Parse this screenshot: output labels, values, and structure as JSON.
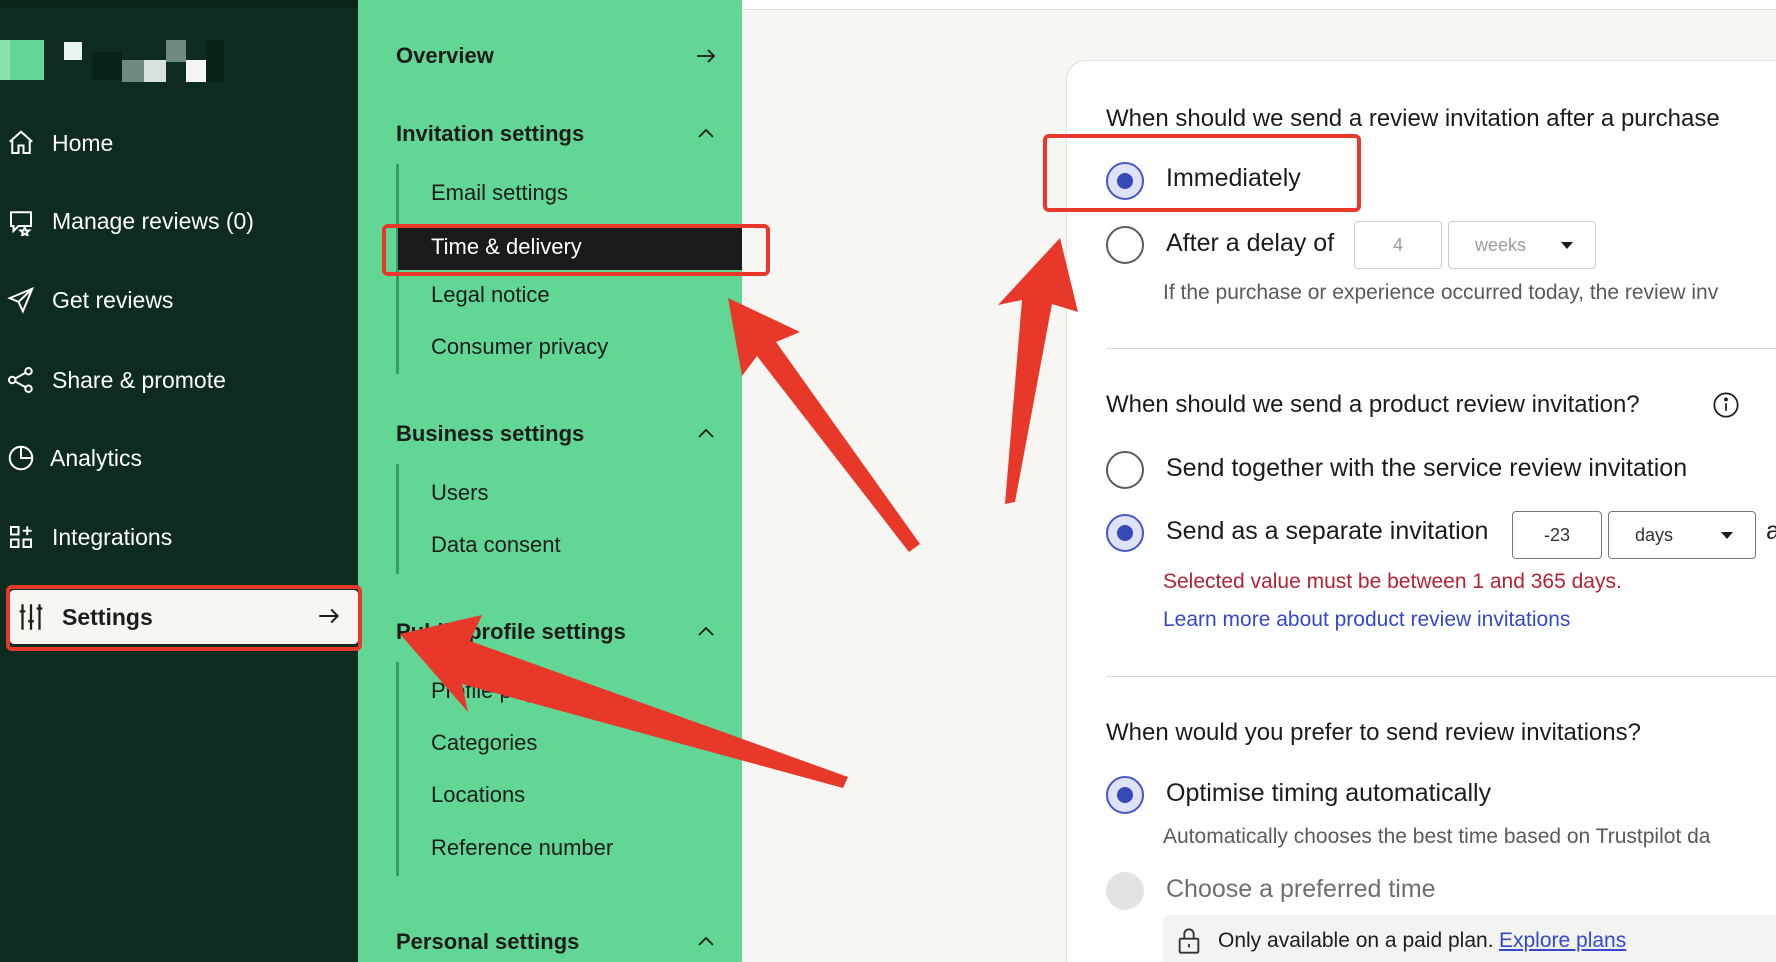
{
  "sidebar": {
    "items": [
      {
        "label": "Home",
        "icon": "home-icon"
      },
      {
        "label": "Manage reviews (0)",
        "icon": "star-chat-icon"
      },
      {
        "label": "Get reviews",
        "icon": "send-icon"
      },
      {
        "label": "Share & promote",
        "icon": "share-icon"
      },
      {
        "label": "Analytics",
        "icon": "pie-chart-icon"
      },
      {
        "label": "Integrations",
        "icon": "grid-plus-icon"
      }
    ],
    "active": {
      "label": "Settings",
      "icon": "sliders-icon"
    }
  },
  "menu": {
    "overview": "Overview",
    "invitation_settings": {
      "title": "Invitation settings",
      "items": [
        "Email settings",
        "Time & delivery",
        "Legal notice",
        "Consumer privacy"
      ]
    },
    "business_settings": {
      "title": "Business settings",
      "items": [
        "Users",
        "Data consent"
      ]
    },
    "public_profile_settings": {
      "title": "Public profile settings",
      "items": [
        "Profile page",
        "Categories",
        "Locations",
        "Reference number"
      ]
    },
    "personal_settings": {
      "title": "Personal settings"
    }
  },
  "content": {
    "q1": {
      "question": "When should we send a review invitation after a purchase",
      "opt_immediately": "Immediately",
      "opt_delay": "After a delay of",
      "delay_value": "4",
      "delay_unit": "weeks",
      "hint": "If the purchase or experience occurred today, the review inv"
    },
    "q2": {
      "question": "When should we send a product review invitation?",
      "opt_together": "Send together with the service review invitation",
      "opt_separate": "Send as a separate invitation",
      "separate_value": "-23",
      "separate_unit": "days",
      "trailing": "a",
      "error": "Selected value must be between 1 and 365 days.",
      "learn_more": "Learn more about product review invitations"
    },
    "q3": {
      "question": "When would you prefer to send review invitations?",
      "opt_auto": "Optimise timing automatically",
      "auto_hint": "Automatically chooses the best time based on Trustpilot da",
      "opt_preferred": "Choose a preferred time",
      "paid_text": "Only available on a paid plan.",
      "explore_plans": "Explore plans"
    }
  },
  "colors": {
    "sidebar_bg": "#0d2b1e",
    "menu_bg": "#62d695",
    "accent_radio": "#3649b8",
    "error": "#b42234",
    "link": "#3449c9",
    "annotation": "#e8382a"
  }
}
